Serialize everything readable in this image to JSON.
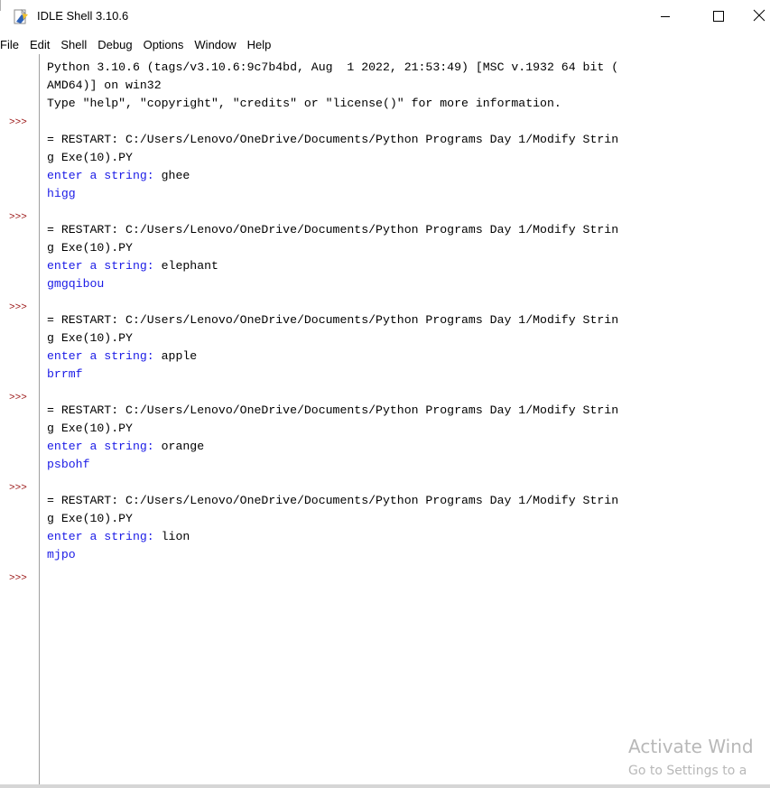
{
  "window": {
    "title": "IDLE Shell 3.10.6"
  },
  "menu": {
    "items": [
      "File",
      "Edit",
      "Shell",
      "Debug",
      "Options",
      "Window",
      "Help"
    ]
  },
  "prompt_symbol": ">>>",
  "lines": {
    "banner_1": "Python 3.10.6 (tags/v3.10.6:9c7b4bd, Aug  1 2022, 21:53:49) [MSC v.1932 64 bit (",
    "banner_2": "AMD64)] on win32",
    "banner_3": "Type \"help\", \"copyright\", \"credits\" or \"license()\" for more information.",
    "restart_1": "= RESTART: C:/Users/Lenovo/OneDrive/Documents/Python Programs Day 1/Modify Strin",
    "restart_2": "g Exe(10).PY",
    "input_prompt": "enter a string: "
  },
  "runs": [
    {
      "input": "ghee",
      "output": "higg"
    },
    {
      "input": "elephant",
      "output": "gmgqibou"
    },
    {
      "input": "apple",
      "output": "brrmf"
    },
    {
      "input": "orange",
      "output": "psbohf"
    },
    {
      "input": "lion",
      "output": "mjpo"
    }
  ],
  "watermark": {
    "title": "Activate Wind",
    "subtitle": "Go to Settings to a"
  },
  "colors": {
    "prompt": "#9a1414",
    "stdout": "#1a1ae6",
    "stdin": "#000000"
  },
  "icons": {
    "app": "idle-feather-icon",
    "minimize": "minimize-icon",
    "maximize": "maximize-icon",
    "close": "close-icon"
  }
}
